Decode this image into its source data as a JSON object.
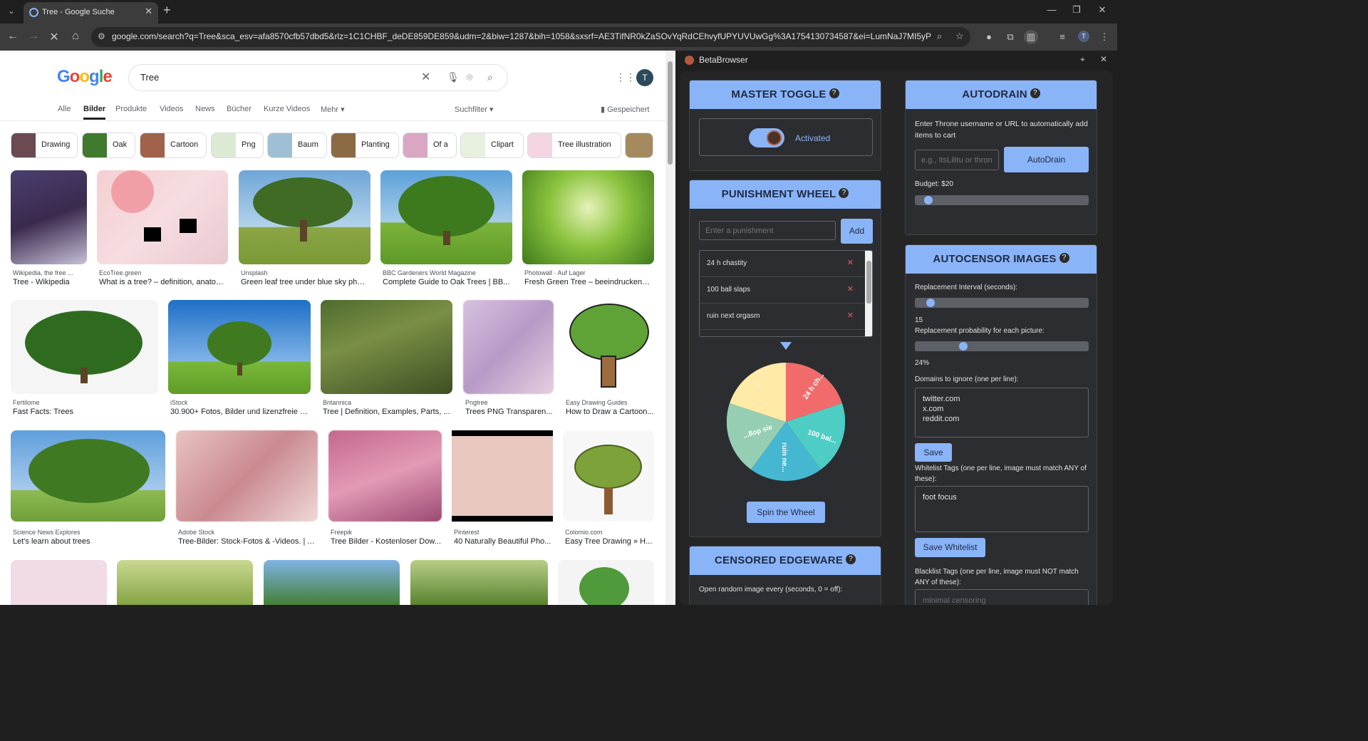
{
  "browser": {
    "tab_title": "Tree - Google Suche",
    "url": "google.com/search?q=Tree&sca_esv=afa8570cfb57dbd5&rlz=1C1CHBF_deDE859DE859&udm=2&biw=1287&bih=1058&sxsrf=AE3TifNR0kZaSOvYqRdCEhvyfUPYUVUwGg%3A1754130734587&ei=LumNaJ7MI5yPxc8P87uewQ...",
    "profile_initial": "T"
  },
  "google": {
    "logo_letters": [
      "G",
      "o",
      "o",
      "g",
      "l",
      "e"
    ],
    "query": "Tree",
    "avatar": "T",
    "tabs": [
      "Alle",
      "Bilder",
      "Produkte",
      "Videos",
      "News",
      "Bücher",
      "Kurze Videos",
      "Mehr ▾"
    ],
    "suchfilter": "Suchfilter ▾",
    "gespeichert": "Gespeichert",
    "chips": [
      "Drawing",
      "Oak",
      "Cartoon",
      "Png",
      "Baum",
      "Planting",
      "Of a",
      "Clipart",
      "Tree illustration"
    ],
    "results": [
      {
        "source": "Wikipedia, the free ...",
        "title": "Tree - Wikipedia"
      },
      {
        "source": "EcoTree.green",
        "title": "What is a tree? – definition, anatom..."
      },
      {
        "source": "Unsplash",
        "title": "Green leaf tree under blue sky phot..."
      },
      {
        "source": "BBC Gardeners World Magazine",
        "title": "Complete Guide to Oak Trees | BB..."
      },
      {
        "source": "Photowall · Auf Lager",
        "title": "Fresh Green Tree – beeindruckend..."
      },
      {
        "source": "Fertilome",
        "title": "Fast Facts: Trees"
      },
      {
        "source": "iStock",
        "title": "30.900+ Fotos, Bilder und lizenzfreie B..."
      },
      {
        "source": "Britannica",
        "title": "Tree | Definition, Examples, Parts, ..."
      },
      {
        "source": "Pngtree",
        "title": "Trees PNG Transparen..."
      },
      {
        "source": "Easy Drawing Guides",
        "title": "How to Draw a Cartoon..."
      },
      {
        "source": "Science News Explores",
        "title": "Let's learn about trees"
      },
      {
        "source": "Adobe Stock",
        "title": "Tree-Bilder: Stock-Fotos & -Videos. | A..."
      },
      {
        "source": "Freepik",
        "title": "Tree Bilder - Kostenloser Dow..."
      },
      {
        "source": "Pinterest",
        "title": "40 Naturally Beautiful Pho..."
      },
      {
        "source": "Colomio.com",
        "title": "Easy Tree Drawing » H..."
      }
    ]
  },
  "panel": {
    "title": "BetaBrowser",
    "master_toggle": {
      "heading": "MASTER TOGGLE",
      "status": "Activated"
    },
    "autodrain": {
      "heading": "AUTODRAIN",
      "description": "Enter Throne username or URL to automatically add items to cart",
      "placeholder": "e.g., ItsLilitu or throne",
      "button": "AutoDrain",
      "budget_label": "Budget: $20",
      "budget_fraction": 0.02
    },
    "punishment_wheel": {
      "heading": "PUNISHMENT WHEEL",
      "placeholder": "Enter a punishment",
      "add_button": "Add",
      "items": [
        "24 h chastity",
        "100 ball slaps",
        "ruin next orgasm"
      ],
      "wheel_labels": [
        "24 h ch...",
        "100 bal...",
        "ruin ne...",
        "...8op sie",
        "..."
      ],
      "spin_button": "Spin the Wheel"
    },
    "autocensor": {
      "heading": "AUTOCENSOR IMAGES",
      "interval_label": "Replacement Interval (seconds):",
      "interval_value": "15",
      "probability_label": "Replacement probability for each picture:",
      "probability_value": "24%",
      "domains_label": "Domains to ignore (one per line):",
      "domains": "twitter.com\nx.com\nreddit.com",
      "save_button": "Save",
      "whitelist_label": "Whitelist Tags (one per line, image must match ANY of these):",
      "whitelist": "foot focus",
      "save_whitelist_button": "Save Whitelist",
      "blacklist_label": "Blacklist Tags (one per line, image must NOT match ANY of these):",
      "blacklist": "minimal censoring"
    },
    "censored_edgeware": {
      "heading": "CENSORED EDGEWARE",
      "open_label": "Open random image every (seconds, 0 = off):"
    }
  }
}
